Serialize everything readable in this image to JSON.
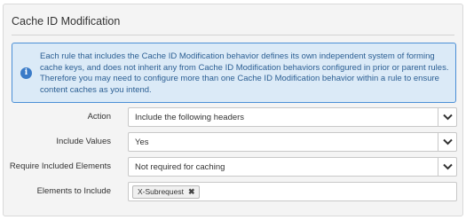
{
  "panel": {
    "title": "Cache ID Modification"
  },
  "notice": {
    "icon": "info-icon",
    "text": "Each rule that includes the Cache ID Modification behavior defines its own independent system of forming cache keys, and does not inherit any from Cache ID Modification behaviors configured in prior or parent rules. Therefore you may need to configure more than one Cache ID Modification behavior within a rule to ensure content caches as you intend."
  },
  "fields": {
    "action": {
      "label": "Action",
      "value": "Include the following headers"
    },
    "include_values": {
      "label": "Include Values",
      "value": "Yes"
    },
    "require_included": {
      "label": "Require Included Elements",
      "value": "Not required for caching"
    },
    "elements": {
      "label": "Elements to Include",
      "tags": [
        "X-Subrequest"
      ],
      "remove_glyph": "✖"
    }
  },
  "colors": {
    "notice_bg": "#dbeaf7",
    "notice_border": "#4b8fd6",
    "notice_text": "#2c5f93",
    "panel_bg": "#f4f4f4"
  }
}
